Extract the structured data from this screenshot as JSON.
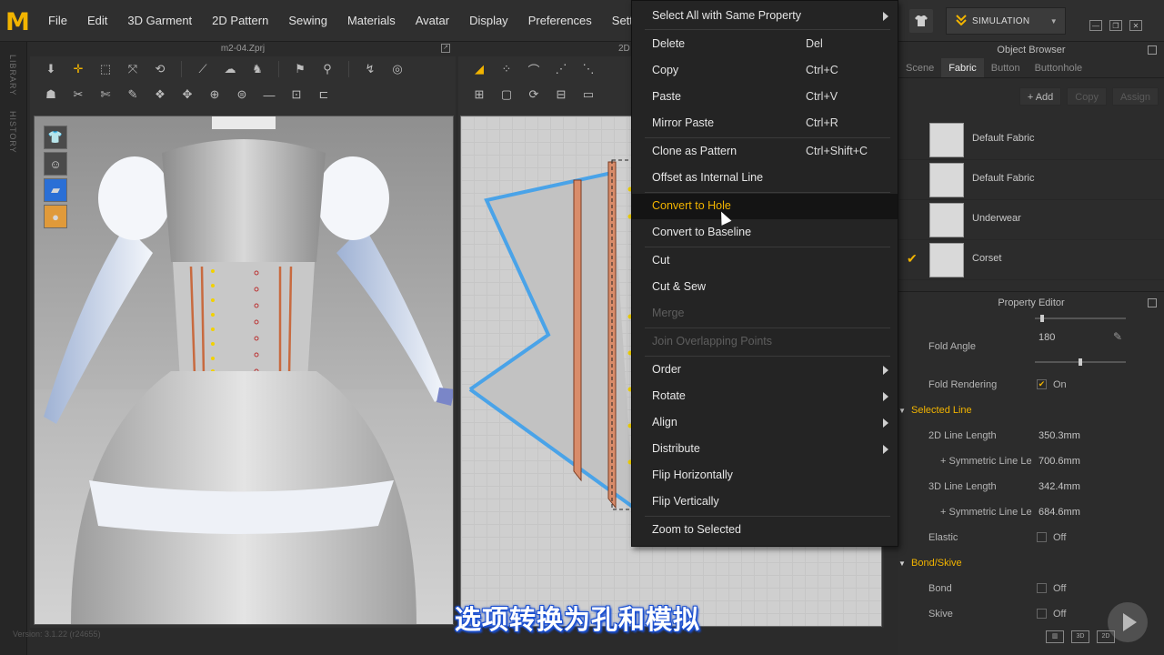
{
  "menubar": {
    "logo": "M",
    "items": [
      "File",
      "Edit",
      "3D Garment",
      "2D Pattern",
      "Sewing",
      "Materials",
      "Avatar",
      "Display",
      "Preferences",
      "Settings"
    ],
    "simulation_label": "SIMULATION"
  },
  "left_strip": {
    "library_label": "LIBRARY",
    "history_label": "HISTORY"
  },
  "panel3d": {
    "title": "m2-04.Zprj"
  },
  "panel2d": {
    "title": "2D"
  },
  "object_browser": {
    "title": "Object Browser",
    "tabs": [
      "Scene",
      "Fabric",
      "Button",
      "Buttonhole"
    ],
    "active_tab": "Fabric",
    "actions": {
      "add": "+ Add",
      "copy": "Copy",
      "assign": "Assign"
    },
    "fabrics": [
      {
        "name": "Default Fabric",
        "checked": false
      },
      {
        "name": "Default Fabric",
        "checked": false
      },
      {
        "name": "Underwear",
        "checked": false
      },
      {
        "name": "Corset",
        "checked": true,
        "check": "✔"
      }
    ]
  },
  "property_editor": {
    "title": "Property Editor",
    "fold_angle": {
      "label": "Fold Angle",
      "value": "180",
      "fraction": 0.5
    },
    "fold_rendering": {
      "label": "Fold Rendering",
      "value": "On",
      "check": "✔"
    },
    "selected_line": {
      "section": "Selected Line",
      "line_2d": {
        "label": "2D Line Length",
        "value": "350.3mm"
      },
      "sym_2d": {
        "label": "+ Symmetric Line Le",
        "value": "700.6mm"
      },
      "line_3d": {
        "label": "3D Line Length",
        "value": "342.4mm"
      },
      "sym_3d": {
        "label": "+ Symmetric Line Le",
        "value": "684.6mm"
      },
      "elastic": {
        "label": "Elastic",
        "value": "Off"
      }
    },
    "bond_skive": {
      "section": "Bond/Skive",
      "bond": {
        "label": "Bond",
        "value": "Off"
      },
      "skive": {
        "label": "Skive",
        "value": "Off"
      }
    }
  },
  "context_menu": {
    "items": [
      {
        "label": "Select All with Same Property",
        "shortcut": "",
        "submenu": true
      },
      {
        "label": "Delete",
        "shortcut": "Del"
      },
      {
        "label": "Copy",
        "shortcut": "Ctrl+C"
      },
      {
        "label": "Paste",
        "shortcut": "Ctrl+V"
      },
      {
        "label": "Mirror Paste",
        "shortcut": "Ctrl+R"
      },
      {
        "label": "Clone as Pattern",
        "shortcut": "Ctrl+Shift+C"
      },
      {
        "label": "Offset as Internal Line",
        "shortcut": ""
      },
      {
        "label": "Convert to Hole",
        "shortcut": "",
        "hovered": true
      },
      {
        "label": "Convert to Baseline",
        "shortcut": ""
      },
      {
        "label": "Cut",
        "shortcut": ""
      },
      {
        "label": "Cut & Sew",
        "shortcut": ""
      },
      {
        "label": "Merge",
        "shortcut": "",
        "disabled": true
      },
      {
        "label": "Join Overlapping Points",
        "shortcut": "",
        "disabled": true
      },
      {
        "label": "Order",
        "shortcut": "",
        "submenu": true
      },
      {
        "label": "Rotate",
        "shortcut": "",
        "submenu": true
      },
      {
        "label": "Align",
        "shortcut": "",
        "submenu": true
      },
      {
        "label": "Distribute",
        "shortcut": "",
        "submenu": true
      },
      {
        "label": "Flip Horizontally",
        "shortcut": ""
      },
      {
        "label": "Flip Vertically",
        "shortcut": ""
      },
      {
        "label": "Zoom to Selected",
        "shortcut": ""
      }
    ]
  },
  "status": {
    "version": "Version: 3.1.22    (r24655)"
  },
  "subtitle": "选项转换为孔和模拟",
  "colors": {
    "accent": "#f2b400",
    "pattern_outline": "#4aa3e8",
    "corset_strip": "#d98c6a"
  }
}
